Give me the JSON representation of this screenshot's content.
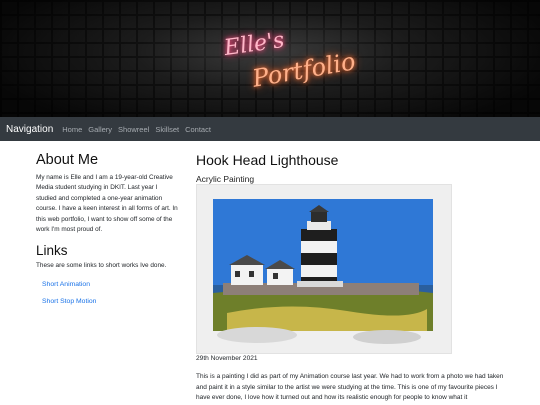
{
  "banner": {
    "logo_line1": "Elle's",
    "logo_line2": "Portfolio"
  },
  "navbar": {
    "brand": "Navigation",
    "links": [
      "Home",
      "Gallery",
      "Showreel",
      "Skillset",
      "Contact"
    ]
  },
  "about": {
    "title": "About Me",
    "text": "My name is Elle and I am a 19-year-old Creative Media student studying in DKIT. Last year I studied and completed a one-year animation course. I have a keen interest in all forms of art. In this web portfolio, I want to show off some of the work I'm most proud of."
  },
  "links": {
    "title": "Links",
    "text": "These are some links to short works Ive done.",
    "items": [
      "Short Animation",
      "Short Stop Motion"
    ]
  },
  "work": {
    "title": "Hook Head Lighthouse",
    "subtitle": "Acrylic Painting",
    "date": "29th November 2021",
    "description": "This is a painting I did as part of my Animation course last year. We had to work from a photo we had taken and paint it in a style similar to the artist we were studying at the time. This is one of my favourite pieces I have ever done, I love how it turned out and how its realistic enough for people to know what it"
  },
  "colors": {
    "navbar": "#343a40",
    "link": "#1a73e8"
  }
}
